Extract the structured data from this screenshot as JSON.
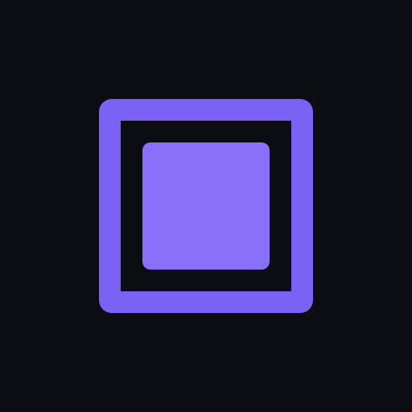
{
  "icon": {
    "name": "stop-square-icon",
    "colors": {
      "background": "#0c0d12",
      "frame": "#7b62f5",
      "fill": "#8a6ff8"
    }
  }
}
